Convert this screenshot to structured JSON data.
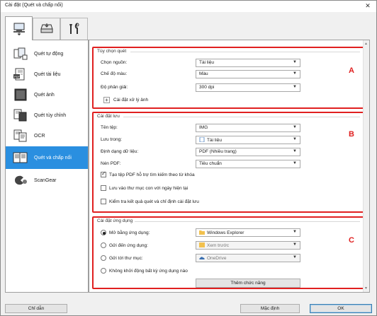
{
  "window": {
    "title": "Cài đặt (Quét và chấp nối)",
    "close_label": "✕"
  },
  "tabs": [
    {
      "name": "scan-from-computer",
      "icon": "computer-scan-icon",
      "active": true
    },
    {
      "name": "scan-from-panel",
      "icon": "scanner-panel-icon",
      "active": false
    },
    {
      "name": "general-settings",
      "icon": "tools-icon",
      "active": false
    }
  ],
  "sidebar": {
    "items": [
      {
        "label": "Quét tự động",
        "icon": "auto-scan-icon",
        "selected": false
      },
      {
        "label": "Quét tài liệu",
        "icon": "document-scan-icon",
        "selected": false
      },
      {
        "label": "Quét ảnh",
        "icon": "photo-scan-icon",
        "selected": false
      },
      {
        "label": "Quét tùy chỉnh",
        "icon": "custom-scan-icon",
        "selected": false
      },
      {
        "label": "OCR",
        "icon": "ocr-icon",
        "selected": false
      },
      {
        "label": "Quét và chấp nối",
        "icon": "stitch-icon",
        "selected": true
      },
      {
        "label": "ScanGear",
        "icon": "scangear-icon",
        "selected": false
      }
    ]
  },
  "scan_options": {
    "title": "Tùy chọn quét",
    "letter": "A",
    "source_label": "Chọn nguồn:",
    "source_value": "Tài liệu",
    "color_label": "Chế độ màu:",
    "color_value": "Màu",
    "resolution_label": "Độ phân giải:",
    "resolution_value": "300 dpi",
    "image_processing_label": "Cài đặt xử lý ảnh",
    "expand_symbol": "+"
  },
  "save_settings": {
    "title": "Cài đặt lưu",
    "letter": "B",
    "filename_label": "Tên tệp:",
    "filename_value": "IMG",
    "save_in_label": "Lưu trong:",
    "save_in_value": "Tài liệu",
    "format_label": "Định dạng dữ liệu:",
    "format_value": "PDF (Nhiều trang)",
    "pdf_compress_label": "Nén PDF:",
    "pdf_compress_value": "Tiêu chuẩn",
    "check_keyword_label": "Tạo tệp PDF hỗ trợ tìm kiếm theo từ khóa",
    "check_keyword": true,
    "check_subfolder_label": "Lưu vào thư mục con với ngày hiện tại",
    "check_subfolder": false,
    "check_verify_label": "Kiểm tra kết quả quét và chỉ định cài đặt lưu",
    "check_verify": false
  },
  "app_settings": {
    "title": "Cài đặt ứng dụng",
    "letter": "C",
    "open_app_label": "Mở bằng ứng dụng:",
    "open_app_value": "Windows Explorer",
    "open_app_selected": true,
    "send_app_label": "Gửi đến ứng dụng:",
    "send_app_value": "Xem trước",
    "send_folder_label": "Gửi tới thư mục:",
    "send_folder_value": "OneDrive",
    "no_app_label": "Không khởi động bất kỳ ứng dụng nào",
    "more_functions_label": "Thêm chức năng"
  },
  "footer": {
    "help_label": "Chỉ dẫn",
    "default_label": "Mặc định",
    "ok_label": "OK"
  },
  "colors": {
    "highlight": "#2a8fe0",
    "annotation": "#e02020",
    "folder": "#f2c14e"
  }
}
